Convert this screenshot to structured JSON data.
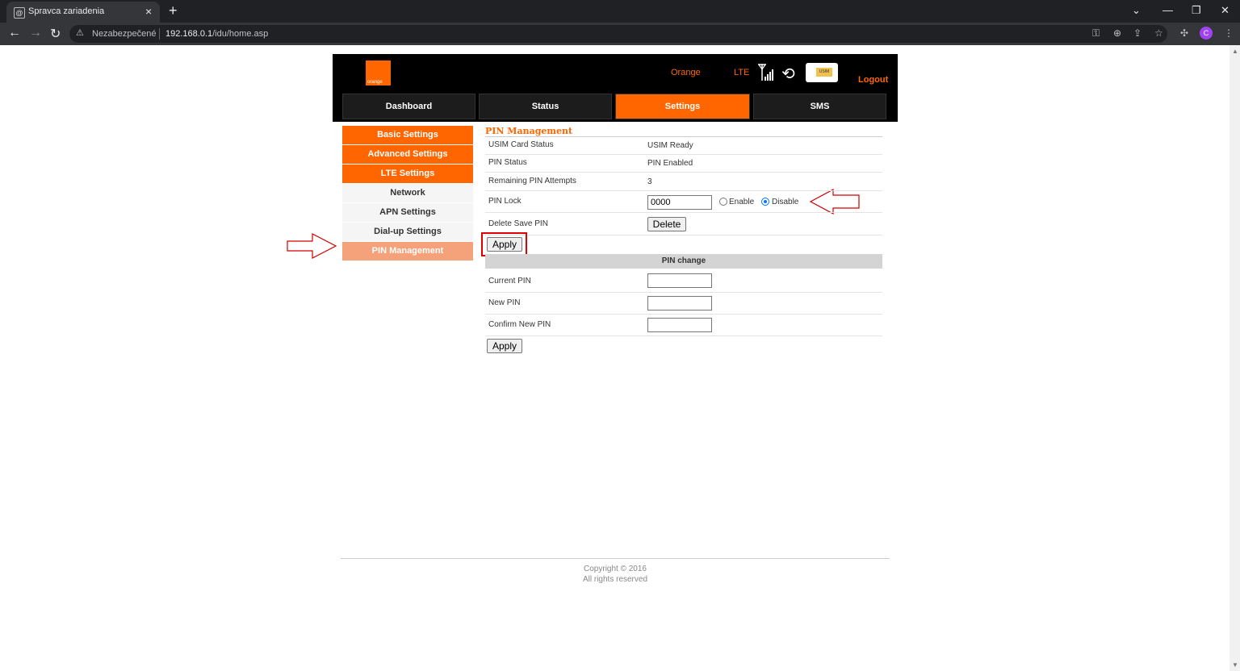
{
  "browser": {
    "tab_title": "Spravca zariadenia",
    "security_label": "Nezabezpečené",
    "url_host": "192.168.0.1",
    "url_path": "/idu/home.asp",
    "profile_initial": "C"
  },
  "header": {
    "logo_text": "orange",
    "operator": "Orange",
    "network_type": "LTE",
    "usim_label": "USIM",
    "logout_label": "Logout"
  },
  "main_nav": [
    {
      "label": "Dashboard"
    },
    {
      "label": "Status"
    },
    {
      "label": "Settings",
      "active": true
    },
    {
      "label": "SMS"
    }
  ],
  "side_menu": [
    {
      "label": "Basic Settings"
    },
    {
      "label": "Advanced Settings"
    },
    {
      "label": "LTE Settings"
    },
    {
      "label": "Network"
    },
    {
      "label": "APN Settings"
    },
    {
      "label": "Dial-up Settings"
    },
    {
      "label": "PIN Management",
      "current": true
    }
  ],
  "pin_management": {
    "title": "PIN Management",
    "usim_status_label": "USIM Card Status",
    "usim_status_value": "USIM Ready",
    "pin_status_label": "PIN Status",
    "pin_status_value": "PIN Enabled",
    "remaining_label": "Remaining PIN Attempts",
    "remaining_value": "3",
    "pin_lock_label": "PIN Lock",
    "pin_lock_value": "0000",
    "enable_label": "Enable",
    "disable_label": "Disable",
    "pin_lock_selected": "Disable",
    "delete_save_label": "Delete Save PIN",
    "delete_button": "Delete",
    "apply_button": "Apply"
  },
  "pin_change": {
    "section_title": "PIN change",
    "current_label": "Current PIN",
    "new_label": "New PIN",
    "confirm_label": "Confirm New PIN",
    "current_value": "",
    "new_value": "",
    "confirm_value": "",
    "apply_button": "Apply"
  },
  "footer": {
    "copyright": "Copyright © 2016",
    "rights": "All rights reserved"
  },
  "colors": {
    "brand_orange": "#ff6600",
    "current_menu": "#f5a27a",
    "annotation_red": "#e00000"
  }
}
